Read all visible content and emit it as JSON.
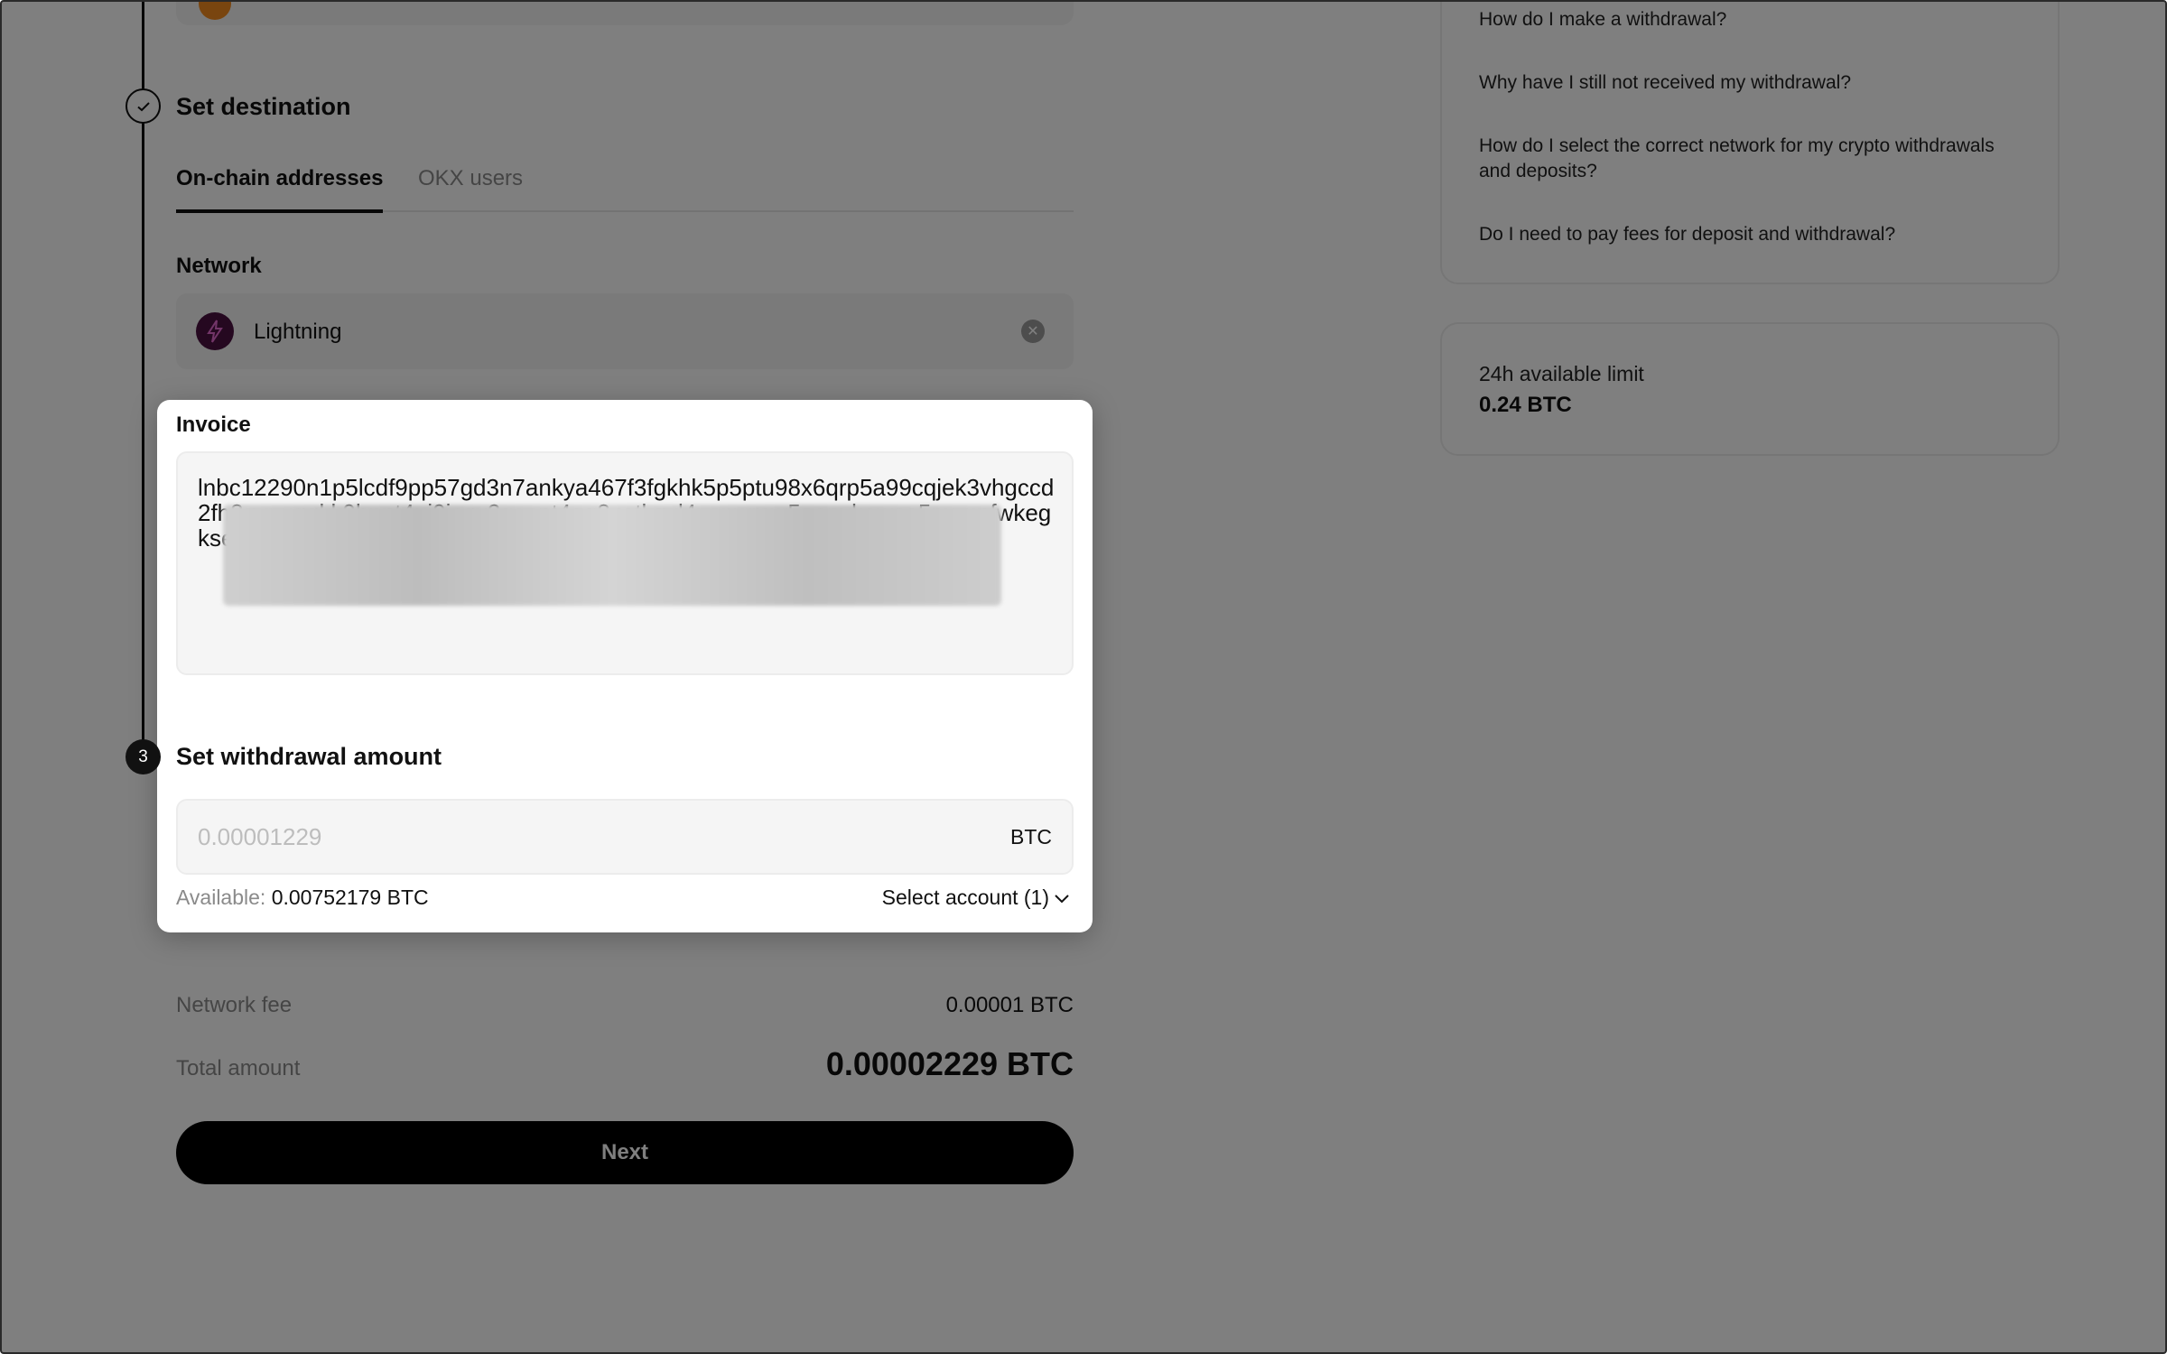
{
  "destination": {
    "title": "Set destination",
    "tabs": [
      {
        "label": "On-chain addresses"
      },
      {
        "label": "OKX users"
      }
    ],
    "network_label": "Network",
    "network_value": "Lightning"
  },
  "invoice": {
    "label": "Invoice",
    "value": "lnbc12290n1p5lcdf9pp57gd3n7ankya467f3fgkhk5p5ptu98x6qrp5a99cqjek3vhgccd2fh8qvuxqqkk9hnnt4uj9jcqy2ggcpt4gq8zetkqyl4usnwrsw5aenvkewca5muunfwkegksedapu5j5u8stc3cskqmxjacch8pgplmky88"
  },
  "amount": {
    "step": "3",
    "title": "Set withdrawal amount",
    "placeholder": "0.00001229",
    "unit": "BTC",
    "available_label": "Available:",
    "available_value": "0.00752179 BTC",
    "select_account": "Select account (1)"
  },
  "summary": {
    "fee_label": "Network fee",
    "fee_value": "0.00001 BTC",
    "total_label": "Total amount",
    "total_value": "0.00002229 BTC",
    "next_label": "Next"
  },
  "faq": {
    "items": [
      "How do I make a withdrawal?",
      "Why have I still not received my withdrawal?",
      "How do I select the correct network for my crypto withdrawals and deposits?",
      "Do I need to pay fees for deposit and withdrawal?"
    ]
  },
  "limit": {
    "label": "24h available limit",
    "value": "0.24 BTC"
  }
}
